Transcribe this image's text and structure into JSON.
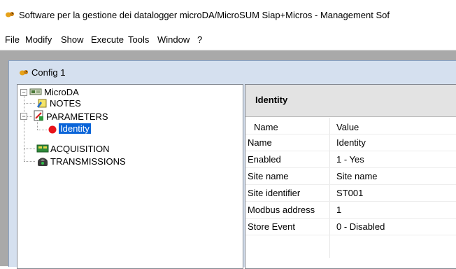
{
  "window": {
    "title": "Software per la gestione dei datalogger microDA/MicroSUM Siap+Micros - Management Sof"
  },
  "menu": [
    "File",
    "Modify",
    "Show",
    "Execute",
    "Tools",
    "Window",
    "?"
  ],
  "child_window": {
    "title": "Config 1"
  },
  "tree": {
    "root": "MicroDA",
    "items": [
      {
        "label": "NOTES",
        "icon": "notes-icon"
      },
      {
        "label": "PARAMETERS",
        "icon": "parameters-icon"
      },
      {
        "label": "Identity",
        "icon": "red-dot-icon",
        "selected": true
      },
      {
        "label": "ACQUISITION",
        "icon": "acquisition-icon"
      },
      {
        "label": "TRANSMISSIONS",
        "icon": "transmissions-icon"
      }
    ]
  },
  "panel": {
    "header": "Identity",
    "columns": [
      "Name",
      "Value"
    ],
    "rows": [
      {
        "name": "Name",
        "value": "Identity"
      },
      {
        "name": "Enabled",
        "value": "1 - Yes"
      },
      {
        "name": "Site name",
        "value": "Site name"
      },
      {
        "name": "Site identifier",
        "value": "ST001"
      },
      {
        "name": "Modbus address",
        "value": "1"
      },
      {
        "name": "Store Event",
        "value": "0 - Disabled"
      }
    ]
  },
  "colors": {
    "selection": "#0a64d8",
    "mdi_background": "#a9a9a9",
    "child_frame": "#d5e0ef"
  }
}
